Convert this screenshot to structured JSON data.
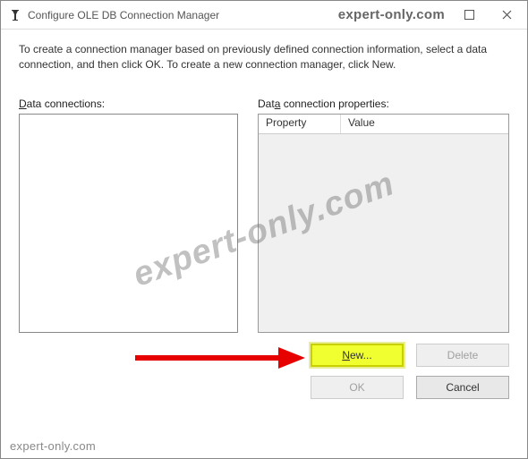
{
  "titlebar": {
    "title": "Configure OLE DB Connection Manager",
    "brand": "expert-only.com"
  },
  "instructions": "To create a connection manager based on previously defined connection information, select a data connection, and then click OK. To create a new connection manager, click New.",
  "labels": {
    "data_connections_prefix": "D",
    "data_connections_rest": "ata connections:",
    "data_props_prefix": "D",
    "data_props_mid": "at",
    "data_props_ul2": "a",
    "data_props_rest": " connection properties:"
  },
  "props_grid": {
    "col_property": "Property",
    "col_value": "Value"
  },
  "buttons": {
    "new_prefix": "N",
    "new_rest": "ew...",
    "delete": "Delete",
    "ok": "OK",
    "cancel": "Cancel"
  },
  "watermark": "expert-only.com",
  "footer_brand": "expert-only.com"
}
